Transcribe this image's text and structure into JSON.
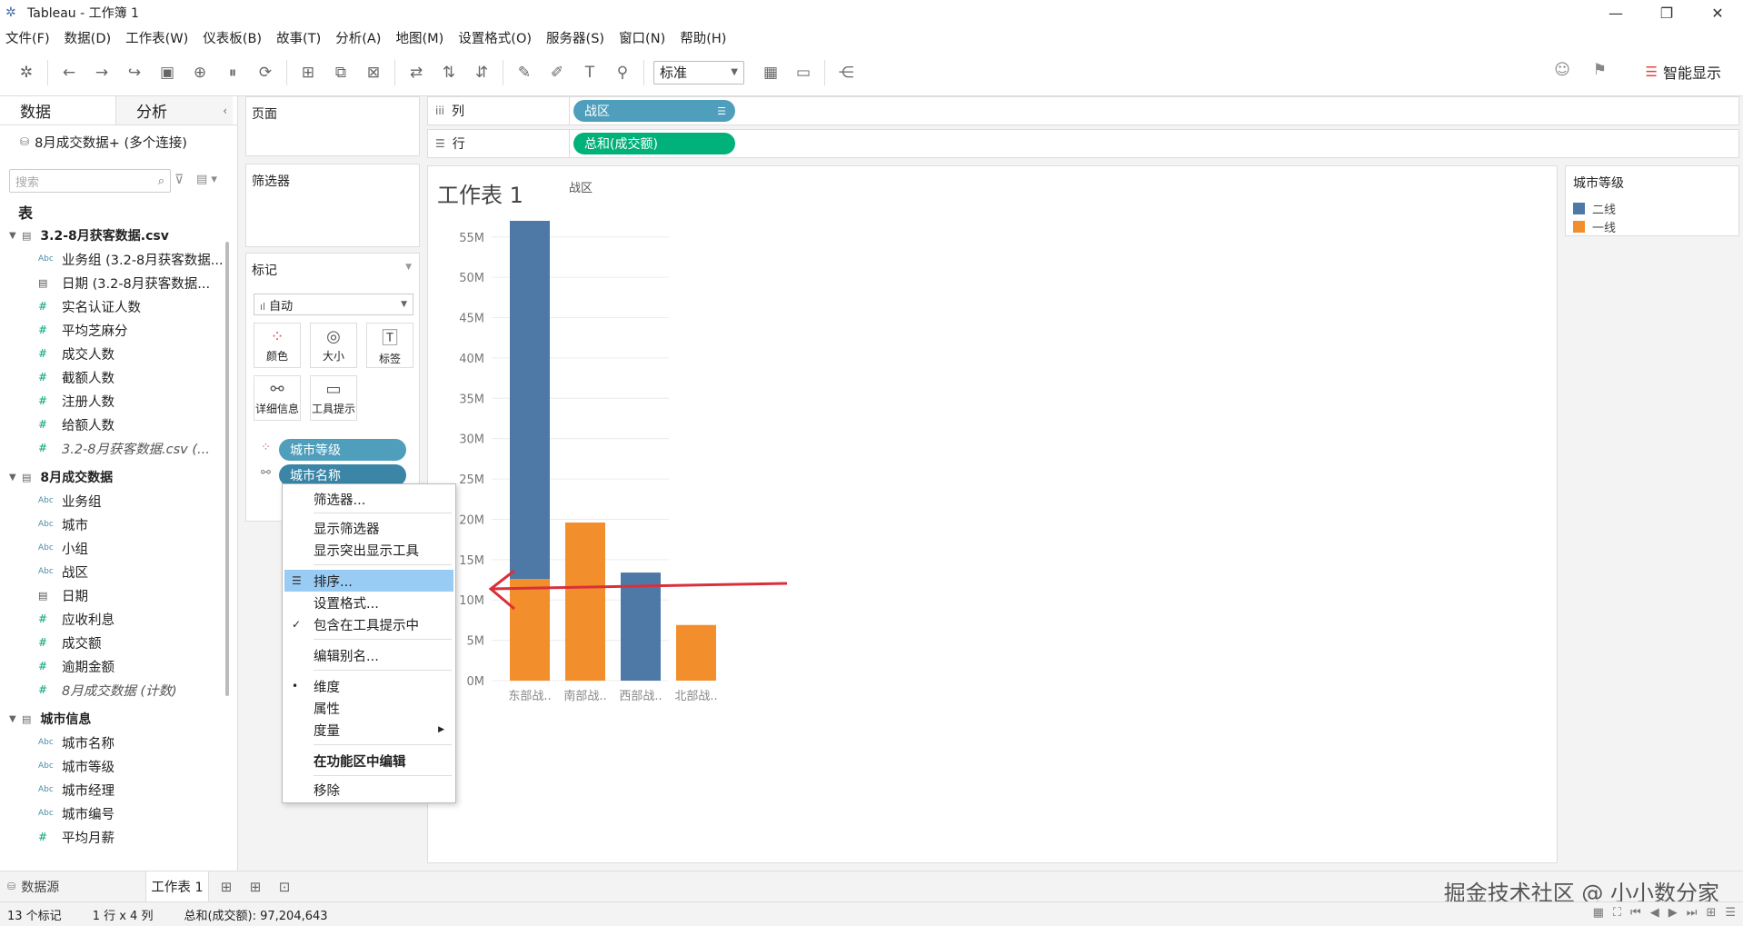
{
  "window": {
    "title": "Tableau - 工作簿 1"
  },
  "menu": [
    "文件(F)",
    "数据(D)",
    "工作表(W)",
    "仪表板(B)",
    "故事(T)",
    "分析(A)",
    "地图(M)",
    "设置格式(O)",
    "服务器(S)",
    "窗口(N)",
    "帮助(H)"
  ],
  "toolbar": {
    "fit_value": "标准",
    "smart_show": "智能显示"
  },
  "left_pane": {
    "tabs": [
      "数据",
      "分析"
    ],
    "connection": "8月成交数据+ (多个连接)",
    "search_placeholder": "搜索",
    "tables_label": "表",
    "groups": [
      {
        "name": "3.2-8月获客数据.csv",
        "fields": [
          {
            "type": "Abc",
            "name": "业务组 (3.2-8月获客数据..."
          },
          {
            "type": "date",
            "name": "日期 (3.2-8月获客数据..."
          },
          {
            "type": "#",
            "name": "实名认证人数"
          },
          {
            "type": "#",
            "name": "平均芝麻分"
          },
          {
            "type": "#",
            "name": "成交人数"
          },
          {
            "type": "#",
            "name": "截额人数"
          },
          {
            "type": "#",
            "name": "注册人数"
          },
          {
            "type": "#",
            "name": "给额人数"
          },
          {
            "type": "#",
            "name": "3.2-8月获客数据.csv (...",
            "italic": true
          }
        ]
      },
      {
        "name": "8月成交数据",
        "fields": [
          {
            "type": "Abc",
            "name": "业务组"
          },
          {
            "type": "Abc",
            "name": "城市"
          },
          {
            "type": "Abc",
            "name": "小组"
          },
          {
            "type": "Abc",
            "name": "战区"
          },
          {
            "type": "date",
            "name": "日期"
          },
          {
            "type": "#",
            "name": "应收利息"
          },
          {
            "type": "#",
            "name": "成交额"
          },
          {
            "type": "#",
            "name": "逾期金额"
          },
          {
            "type": "#",
            "name": "8月成交数据 (计数)",
            "italic": true
          }
        ]
      },
      {
        "name": "城市信息",
        "fields": [
          {
            "type": "Abc",
            "name": "城市名称"
          },
          {
            "type": "Abc",
            "name": "城市等级"
          },
          {
            "type": "Abc",
            "name": "城市经理"
          },
          {
            "type": "Abc",
            "name": "城市编号"
          },
          {
            "type": "#",
            "name": "平均月薪"
          }
        ]
      }
    ]
  },
  "cards": {
    "pages": "页面",
    "filters": "筛选器",
    "marks": "标记",
    "marks_type": "自动",
    "mark_buttons": [
      "颜色",
      "大小",
      "标签",
      "详细信息",
      "工具提示"
    ],
    "mark_pills": [
      "城市等级",
      "城市名称"
    ]
  },
  "shelves": {
    "columns_label": "列",
    "rows_label": "行",
    "columns_pill": "战区",
    "rows_pill": "总和(成交额)"
  },
  "sheet": {
    "title": "工作表 1"
  },
  "legend": {
    "title": "城市等级",
    "items": [
      {
        "label": "二线",
        "color": "#4e79a7"
      },
      {
        "label": "一线",
        "color": "#f28e2b"
      }
    ]
  },
  "context_menu": {
    "items": [
      {
        "label": "筛选器..."
      },
      {
        "label": "显示筛选器"
      },
      {
        "label": "显示突出显示工具"
      },
      {
        "label": "排序...",
        "highlighted": true
      },
      {
        "label": "设置格式..."
      },
      {
        "label": "包含在工具提示中",
        "checked": true
      },
      {
        "label": "编辑别名..."
      },
      {
        "label": "维度",
        "selected": true
      },
      {
        "label": "属性"
      },
      {
        "label": "度量",
        "submenu": true
      },
      {
        "label": "在功能区中编辑",
        "bold": true
      },
      {
        "label": "移除"
      }
    ]
  },
  "chart_data": {
    "type": "bar",
    "stacked": true,
    "header": "战区",
    "categories": [
      "东部战..",
      "南部战..",
      "西部战..",
      "北部战.."
    ],
    "series": [
      {
        "name": "一线",
        "color": "#f28e2b",
        "values": [
          12.6,
          19.6,
          0,
          6.9
        ]
      },
      {
        "name": "二线",
        "color": "#4e79a7",
        "values": [
          44.4,
          0,
          13.4,
          0
        ]
      }
    ],
    "yticks": [
      "0M",
      "5M",
      "10M",
      "15M",
      "20M",
      "25M",
      "30M",
      "35M",
      "40M",
      "45M",
      "50M",
      "55M"
    ],
    "ylim": [
      0,
      57
    ],
    "grid": true
  },
  "bottom": {
    "datasource_tab": "数据源",
    "sheet_tab": "工作表 1",
    "watermark": "掘金技术社区 @ 小小数分家"
  },
  "status": {
    "marks": "13 个标记",
    "dims": "1 行 x 4 列",
    "sum": "总和(成交额): 97,204,643"
  }
}
